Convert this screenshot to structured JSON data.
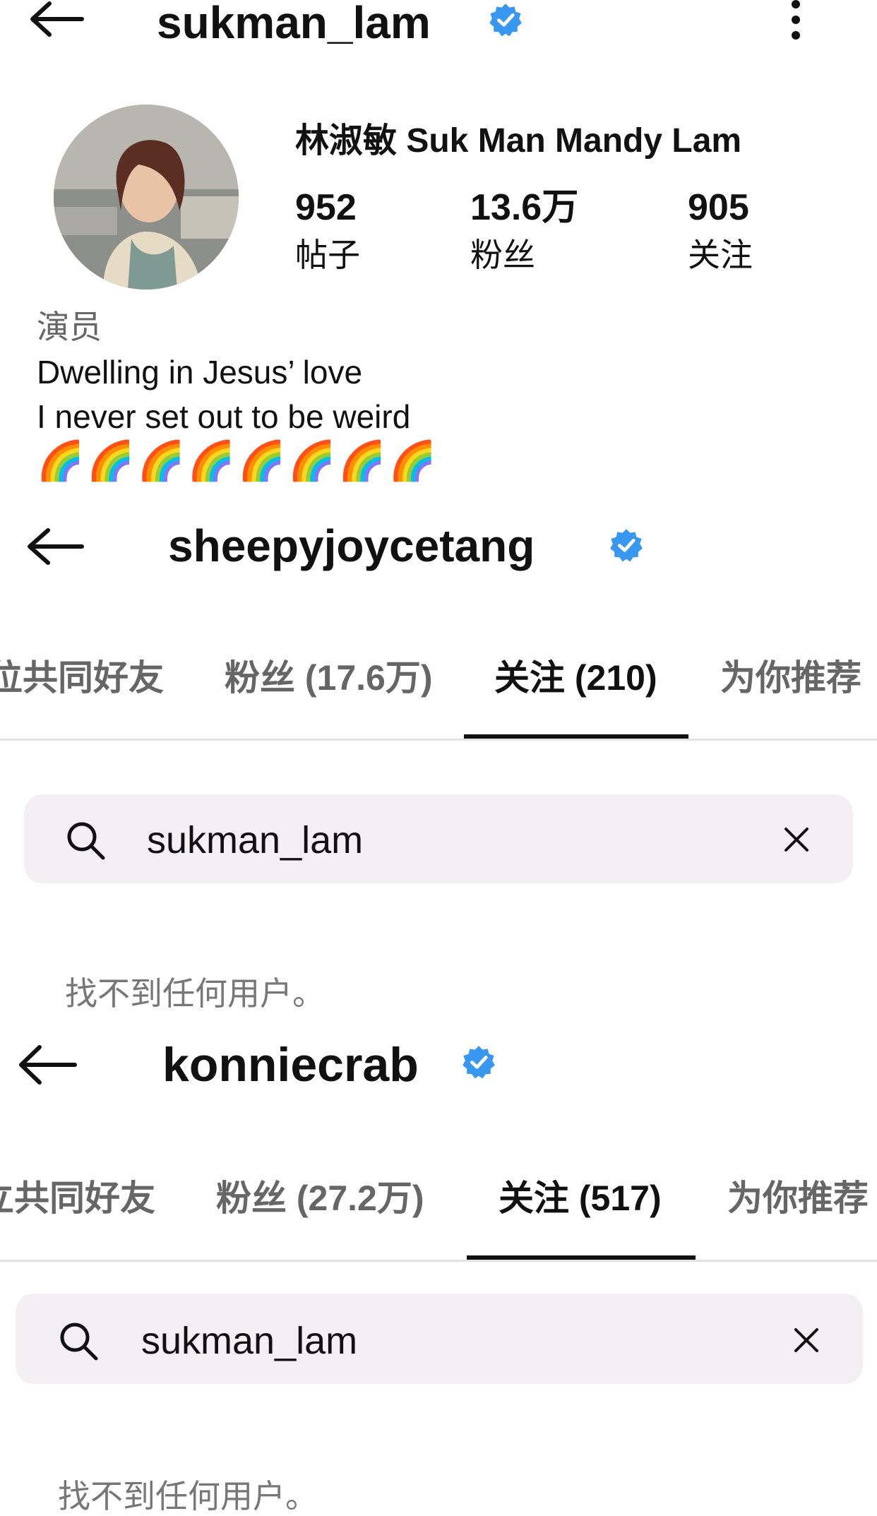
{
  "panel1": {
    "username": "sukman_lam",
    "display_name": "林淑敏 Suk Man Mandy Lam",
    "stats": [
      {
        "value": "952",
        "label": "帖子"
      },
      {
        "value": "13.6万",
        "label": "粉丝"
      },
      {
        "value": "905",
        "label": "关注"
      }
    ],
    "bio": {
      "category": "演员",
      "line1": "Dwelling in Jesus’ love",
      "line2": "I never set out to be weird",
      "emoji_row": "🌈🌈🌈🌈🌈🌈🌈🌈"
    }
  },
  "panel2": {
    "username": "sheepyjoycetang",
    "tabs": [
      "位共同好友",
      "粉丝 (17.6万)",
      "关注 (210)",
      "为你推荐"
    ],
    "active_tab": 2,
    "search_value": "sukman_lam",
    "empty_message": "找不到任何用户。"
  },
  "panel3": {
    "username": "konniecrab",
    "tabs": [
      "立共同好友",
      "粉丝 (27.2万)",
      "关注 (517)",
      "为你推荐"
    ],
    "active_tab": 2,
    "search_value": "sukman_lam",
    "empty_message": "找不到任何用户。"
  },
  "icons": {
    "back": "arrow-left-icon",
    "more": "more-vertical-icon",
    "verified": "verified-badge-icon",
    "search": "search-icon",
    "clear": "close-icon"
  },
  "colors": {
    "verified_blue": "#3897f0",
    "search_bg": "#f3eff3",
    "text": "#111111",
    "muted": "#777777"
  }
}
